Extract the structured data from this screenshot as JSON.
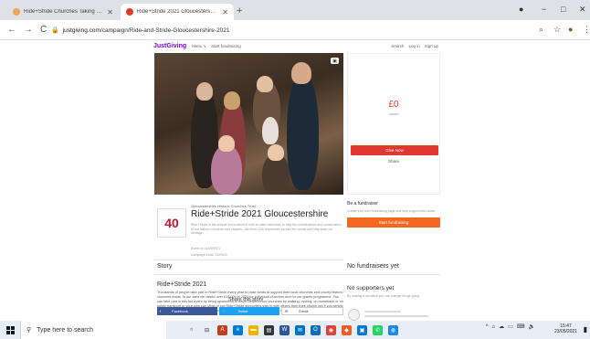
{
  "browser": {
    "tabs": [
      {
        "title": "Ride+Stride Churches Taking Par",
        "active": false
      },
      {
        "title": "Ride+Stride 2021 Gloucestershire",
        "active": true
      }
    ],
    "new_tab": "+",
    "window_controls": {
      "minimize": "−",
      "maximize": "□",
      "close": "✕"
    },
    "address": {
      "host": "justgiving.com",
      "path": "/campaign/Ride-and-Stride-Gloucestershire-2021"
    },
    "nav": {
      "back": "←",
      "forward": "→",
      "reload": "C"
    }
  },
  "site_nav": {
    "logo": "JustGiving",
    "links": [
      "Menu ∨",
      "Start fundraising"
    ],
    "right_links": [
      "Search",
      "Log in",
      "Sign up"
    ]
  },
  "donation": {
    "amount": "£0",
    "raised_label": "raised",
    "give_button": "Give Now",
    "share_link": "Share"
  },
  "charity": {
    "org": "Gloucestershire Historic Churches Trust",
    "logo_text": "40",
    "title": "Ride+Stride 2021 Gloucestershire",
    "description": "Ride+Stride is the annual event which is held to raise vital funds to help the maintenance and conservation of our historic churches and chapels. Join from 11th September across the county and help save our heritage.",
    "meta1": "Event on 11/09/2021",
    "meta2": "Campaign ends: 11/09/21"
  },
  "fundraise": {
    "heading": "Be a fundraiser",
    "text": "Create your own fundraising page and help support this cause",
    "button": "Start fundraising"
  },
  "story": {
    "heading": "Story",
    "title": "Ride+Stride 2021",
    "body": "Thousands of people take part in Ride+Stride every year to raise funds to support their local churches and county historic churches trusts. In our area we raised over £44,000 in 2020 for individual churches and for our grants programme. You can take part in this fun event by being sponsored to travel between our churches by walking, cycling, on horseback or on public transport or your own car! Most of our Ride+Stride supporters sign in with others from their church but if you simply would like to help save historic churches and support the Trust, you can sign up on your own."
  },
  "fundraisers": {
    "heading": "No fundraisers yet"
  },
  "supporters": {
    "heading": "No supporters yet",
    "text": "By making a donation you can change things going"
  },
  "share": {
    "heading": "Share this story",
    "buttons": [
      "Facebook",
      "Twitter",
      "Email"
    ]
  },
  "taskbar": {
    "search_placeholder": "Type here to search",
    "time": "15:47",
    "date": "23/05/2021"
  }
}
